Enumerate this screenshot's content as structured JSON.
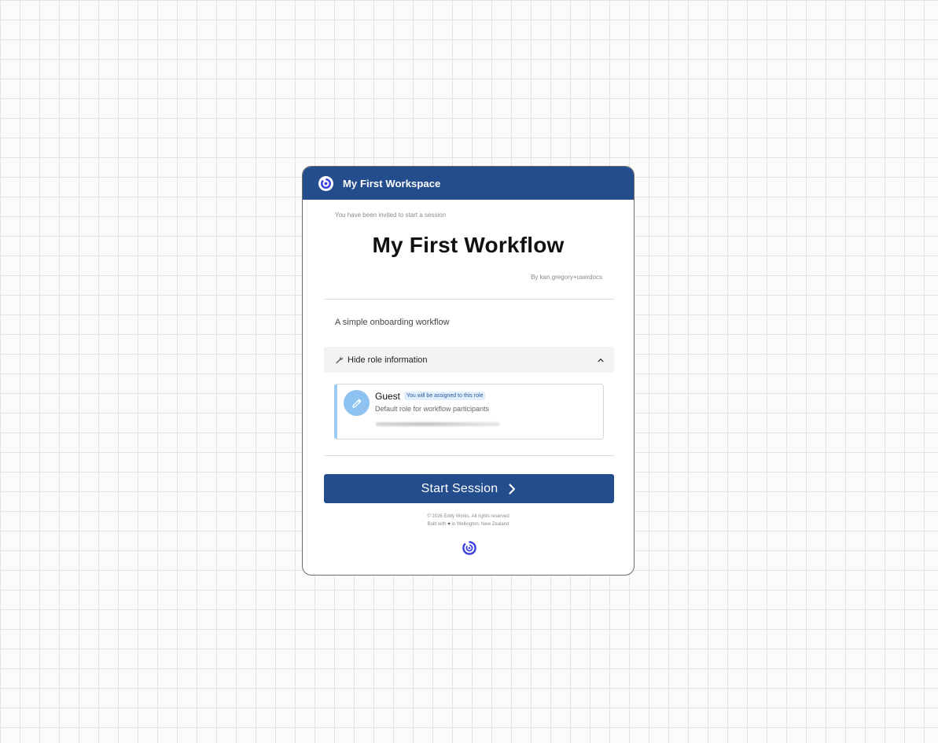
{
  "header": {
    "workspace_title": "My First Workspace"
  },
  "main": {
    "invite_text": "You have been invited to start a session",
    "title": "My First Workflow",
    "byline": "By kan.gregory+userdocs",
    "description": "A simple onboarding workflow"
  },
  "roles_section": {
    "toggle_label": "Hide role information",
    "role": {
      "name": "Guest",
      "badge": "You will be assigned to this role",
      "description": "Default role for workflow participants"
    }
  },
  "actions": {
    "start_label": "Start Session"
  },
  "footer": {
    "copyright": "© 2026 Eddy Works. All rights reserved",
    "built_with_prefix": "Built with",
    "built_with_suffix": "in Wellington, New Zealand"
  },
  "icons": {
    "logo": "brand-logo-icon",
    "toggle": "wrench-icon",
    "collapse": "chevron-up-icon",
    "role_avatar": "pencil-icon",
    "start_arrow": "chevron-right-icon",
    "heart": "heart-icon"
  },
  "colors": {
    "brand": "#234d8c",
    "accent_logo": "#3a3fe0",
    "role_accent": "#9ecbf2"
  }
}
